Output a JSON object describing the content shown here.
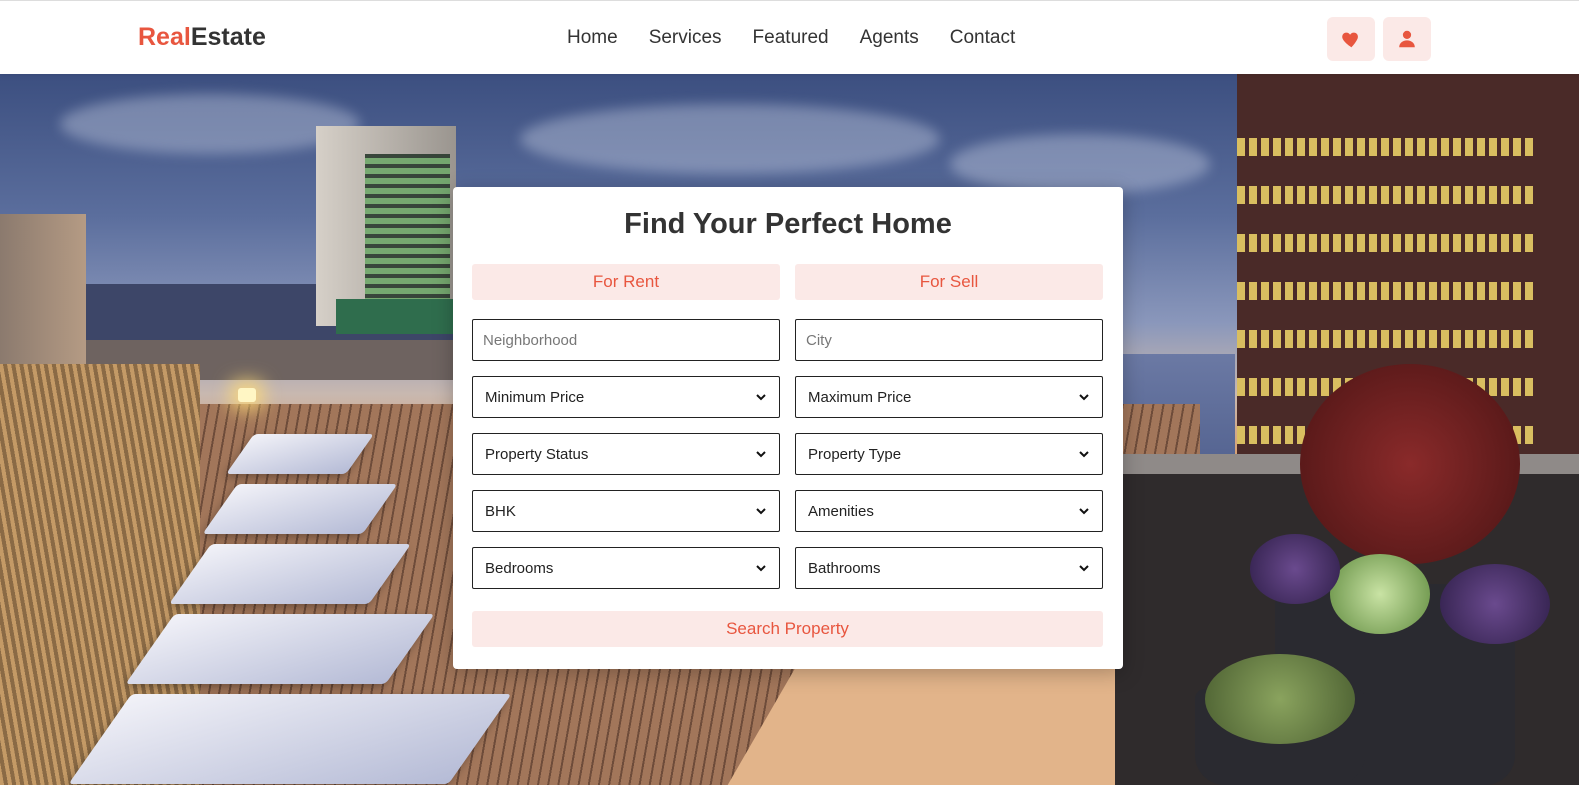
{
  "brand": {
    "logo_accent": "Real",
    "logo_rest": "Estate",
    "accent_color": "#e8563f"
  },
  "nav": {
    "items": [
      "Home",
      "Services",
      "Featured",
      "Agents",
      "Contact"
    ]
  },
  "header_icons": [
    "heart-icon",
    "user-icon"
  ],
  "search_card": {
    "title": "Find Your Perfect Home",
    "tabs": {
      "rent": "For Rent",
      "sell": "For Sell"
    },
    "neighborhood_placeholder": "Neighborhood",
    "city_placeholder": "City",
    "selects": {
      "min_price": "Minimum Price",
      "max_price": "Maximum Price",
      "property_status": "Property Status",
      "property_type": "Property Type",
      "bhk": "BHK",
      "amenities": "Amenities",
      "bedrooms": "Bedrooms",
      "bathrooms": "Bathrooms"
    },
    "search_button": "Search Property"
  }
}
